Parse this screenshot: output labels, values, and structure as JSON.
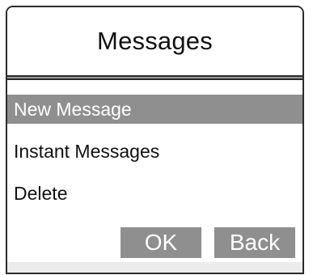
{
  "header": {
    "title": "Messages"
  },
  "menu": {
    "items": [
      {
        "label": "New Message",
        "selected": true
      },
      {
        "label": "Instant Messages",
        "selected": false
      },
      {
        "label": "Delete",
        "selected": false
      }
    ]
  },
  "softkeys": {
    "ok_label": "OK",
    "back_label": "Back"
  },
  "colors": {
    "selection_bg": "#8f8f8f",
    "text": "#111111",
    "frame": "#2b2b2b"
  }
}
